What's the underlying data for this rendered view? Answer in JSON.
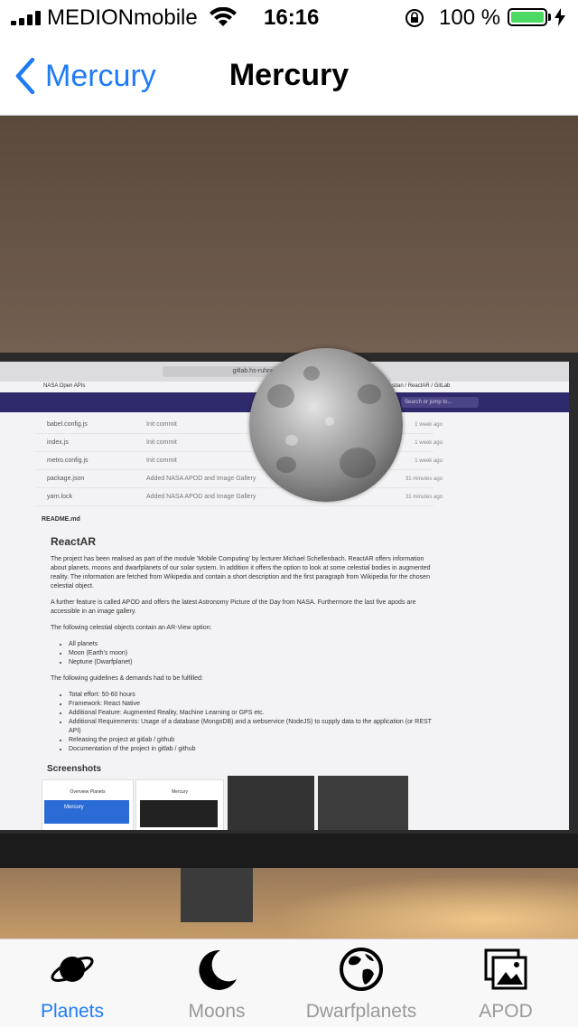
{
  "status_bar": {
    "carrier": "MEDIONmobile",
    "time": "16:16",
    "battery_percent": "100 %",
    "battery_level": 1.0
  },
  "navigation": {
    "back_label": "Mercury",
    "title": "Mercury"
  },
  "ar_view": {
    "browser": {
      "url": "gitlab.hs-ruhrwest.de",
      "tab": "NASA Open APIs",
      "search_placeholder": "Search or jump to...",
      "breadcrumb": "Sebastian / ReactAR / GitLab"
    },
    "files": [
      {
        "name": "babel.config.js",
        "message": "Init commit",
        "age": "1 week ago"
      },
      {
        "name": "index.js",
        "message": "Init commit",
        "age": "1 week ago"
      },
      {
        "name": "metro.config.js",
        "message": "Init commit",
        "age": "1 week ago"
      },
      {
        "name": "package.json",
        "message": "Added NASA APOD and Image Gallery",
        "age": "31 minutes ago"
      },
      {
        "name": "yarn.lock",
        "message": "Added NASA APOD and Image Gallery",
        "age": "31 minutes ago"
      }
    ],
    "readme": {
      "file_title": "README.md",
      "heading": "ReactAR",
      "paragraph1": "The project has been realised as part of the module 'Mobile Computing' by lecturer Michael Schellenbach. ReactAR offers information about planets, moons and dwarfplanets of our solar system. In addition it offers the option to look at some celestial bodies in augmented reality. The information are fetched from Wikipedia and contain a short description and the first paragraph from Wikipedia for the chosen celestial object.",
      "paragraph2": "A further feature is called APOD and offers the latest Astronomy Picture of the Day from NASA. Furthermore the last five apods are accessible in an image gallery.",
      "paragraph3": "The following celestial objects contain an AR-View option:",
      "ar_objects": [
        "All planets",
        "Moon (Earth's moon)",
        "Neptune (Dwarfplanet)"
      ],
      "paragraph4": "The following guidelines & demands had to be fulfilled:",
      "demands": [
        "Total effort: 50-60 hours",
        "Framework: React Native",
        "Additional Feature: Augmented Reality, Machine Learning or GPS etc.",
        "Additional Requirements: Usage of a database (MongoDB) and a webservice (NodeJS) to supply data to the application (or REST API)",
        "Releasing the project at gitlab / github",
        "Documentation of the project in gitlab / github"
      ],
      "screenshots_heading": "Screenshots",
      "shot_label_1": "Overview Planets",
      "shot_label_2": "Mercury",
      "shot_card_title": "Mercury"
    }
  },
  "tab_bar": {
    "tabs": [
      {
        "label": "Planets",
        "icon": "planet-icon",
        "active": true
      },
      {
        "label": "Moons",
        "icon": "moon-icon",
        "active": false
      },
      {
        "label": "Dwarfplanets",
        "icon": "globe-icon",
        "active": false
      },
      {
        "label": "APOD",
        "icon": "photos-icon",
        "active": false
      }
    ]
  },
  "colors": {
    "accent": "#1e7bf6",
    "inactive_tab": "#999999",
    "battery": "#4cd964"
  }
}
